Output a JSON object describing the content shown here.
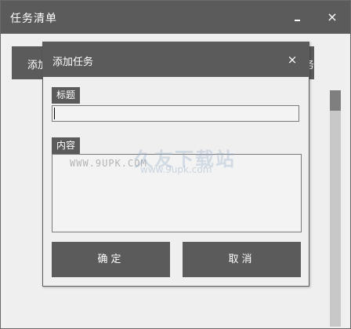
{
  "main": {
    "title": "任务清单",
    "minimize_icon": "minimize-icon",
    "close_glyph": "×",
    "add_button_left": "添加",
    "add_button_right": "务"
  },
  "dialog": {
    "title": "添加任务",
    "close_glyph": "×",
    "title_label": "标题",
    "title_value": "",
    "content_label": "内容",
    "content_value": "",
    "confirm_label": "确定",
    "cancel_label": "取消"
  },
  "watermark": {
    "domain": "WWW.9UPK.COM",
    "logo": "久友下载站",
    "url": "www.9upk.com"
  },
  "colors": {
    "titlebar": "#5b5b5b",
    "background": "#efefef",
    "border": "#7a7a7a"
  }
}
